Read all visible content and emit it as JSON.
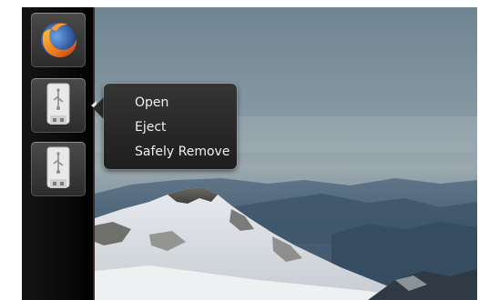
{
  "launcher": {
    "items": [
      {
        "icon": "firefox-icon"
      },
      {
        "icon": "usb-drive-icon"
      },
      {
        "icon": "usb-drive-icon"
      }
    ]
  },
  "context_menu": {
    "items": [
      {
        "label": "Open"
      },
      {
        "label": "Eject"
      },
      {
        "label": "Safely Remove"
      }
    ]
  },
  "colors": {
    "launcher_bg": "#0b0b0b",
    "menu_bg": "#2a2a2a",
    "menu_text": "#f0f0f0",
    "firefox_orange": "#e8791c",
    "firefox_globe": "#2a5bb5"
  }
}
